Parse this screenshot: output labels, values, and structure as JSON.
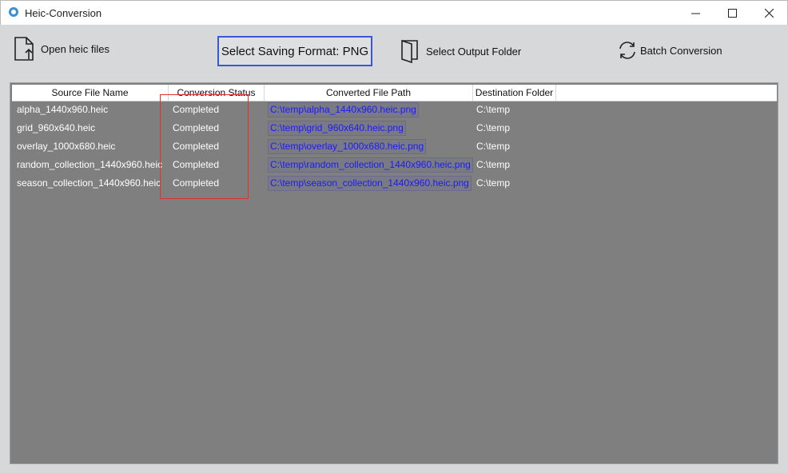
{
  "window": {
    "title": "Heic-Conversion",
    "minimize": "—",
    "maximize": "☐",
    "close": "✕"
  },
  "toolbar": {
    "open_label": "Open heic files",
    "format_label": "Select Saving Format: PNG",
    "output_label": "Select Output Folder",
    "batch_label": "Batch Conversion"
  },
  "table": {
    "headers": [
      "Source File Name",
      "Conversion Status",
      "Converted File Path",
      "Destination Folder"
    ],
    "rows": [
      {
        "source": "alpha_1440x960.heic",
        "status": "Completed",
        "path": "C:\\temp\\alpha_1440x960.heic.png",
        "dest": "C:\\temp"
      },
      {
        "source": "grid_960x640.heic",
        "status": "Completed",
        "path": "C:\\temp\\grid_960x640.heic.png",
        "dest": "C:\\temp"
      },
      {
        "source": "overlay_1000x680.heic",
        "status": "Completed",
        "path": "C:\\temp\\overlay_1000x680.heic.png",
        "dest": "C:\\temp"
      },
      {
        "source": "random_collection_1440x960.heic",
        "status": "Completed",
        "path": "C:\\temp\\random_collection_1440x960.heic.png",
        "dest": "C:\\temp"
      },
      {
        "source": "season_collection_1440x960.heic",
        "status": "Completed",
        "path": "C:\\temp\\season_collection_1440x960.heic.png",
        "dest": "C:\\temp"
      }
    ]
  },
  "colors": {
    "accent_border": "#3a57d6",
    "link": "#1a1aff",
    "grid_bg": "#7f7f7f",
    "highlight": "#e03030"
  }
}
